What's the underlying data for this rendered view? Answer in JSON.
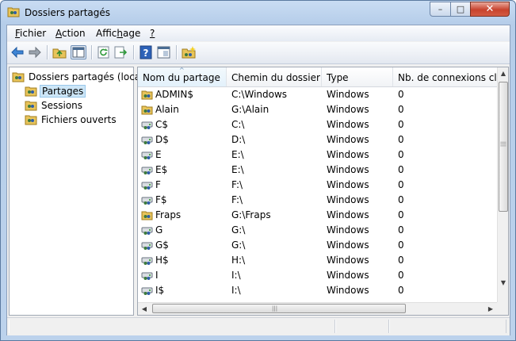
{
  "window": {
    "title": "Dossiers partagés",
    "minimize_glyph": "–",
    "maximize_glyph": "□",
    "close_glyph": "✕"
  },
  "menu": [
    {
      "label": "Fichier",
      "key": "F",
      "rest": "ichier"
    },
    {
      "label": "Action",
      "key": "A",
      "rest": "ction"
    },
    {
      "label": "Affichage",
      "pre": "Affic",
      "key": "h",
      "rest": "age"
    },
    {
      "label": "?",
      "key": "?",
      "rest": ""
    }
  ],
  "toolbar": [
    "back-arrow-icon",
    "forward-arrow-icon",
    "up-folder-icon",
    "show-hide-tree-icon",
    "refresh-icon",
    "export-list-icon",
    "help-icon",
    "properties-icon",
    "new-share-icon"
  ],
  "tree": {
    "root": "Dossiers partagés (local)",
    "children": [
      "Partages",
      "Sessions",
      "Fichiers ouverts"
    ],
    "selected": "Partages"
  },
  "columns": [
    "Nom du partage",
    "Chemin du dossier",
    "Type",
    "Nb. de connexions clier"
  ],
  "sort_arrow": "^",
  "rows": [
    {
      "name": "ADMIN$",
      "path": "C:\\Windows",
      "type": "Windows",
      "connections": "0",
      "icon": "shared-folder-icon"
    },
    {
      "name": "Alain",
      "path": "G:\\Alain",
      "type": "Windows",
      "connections": "0",
      "icon": "shared-folder-icon"
    },
    {
      "name": "C$",
      "path": "C:\\",
      "type": "Windows",
      "connections": "0",
      "icon": "shared-drive-icon"
    },
    {
      "name": "D$",
      "path": "D:\\",
      "type": "Windows",
      "connections": "0",
      "icon": "shared-drive-icon"
    },
    {
      "name": "E",
      "path": "E:\\",
      "type": "Windows",
      "connections": "0",
      "icon": "shared-drive-icon"
    },
    {
      "name": "E$",
      "path": "E:\\",
      "type": "Windows",
      "connections": "0",
      "icon": "shared-drive-icon"
    },
    {
      "name": "F",
      "path": "F:\\",
      "type": "Windows",
      "connections": "0",
      "icon": "shared-drive-icon"
    },
    {
      "name": "F$",
      "path": "F:\\",
      "type": "Windows",
      "connections": "0",
      "icon": "shared-drive-icon"
    },
    {
      "name": "Fraps",
      "path": "G:\\Fraps",
      "type": "Windows",
      "connections": "0",
      "icon": "shared-folder-icon"
    },
    {
      "name": "G",
      "path": "G:\\",
      "type": "Windows",
      "connections": "0",
      "icon": "shared-drive-icon"
    },
    {
      "name": "G$",
      "path": "G:\\",
      "type": "Windows",
      "connections": "0",
      "icon": "shared-drive-icon"
    },
    {
      "name": "H$",
      "path": "H:\\",
      "type": "Windows",
      "connections": "0",
      "icon": "shared-drive-icon"
    },
    {
      "name": "I",
      "path": "I:\\",
      "type": "Windows",
      "connections": "0",
      "icon": "shared-drive-icon"
    },
    {
      "name": "I$",
      "path": "I:\\",
      "type": "Windows",
      "connections": "0",
      "icon": "shared-drive-icon"
    }
  ],
  "scroll": {
    "up": "▲",
    "down": "▼",
    "left": "◀",
    "right": "▶",
    "grip": "|||"
  }
}
